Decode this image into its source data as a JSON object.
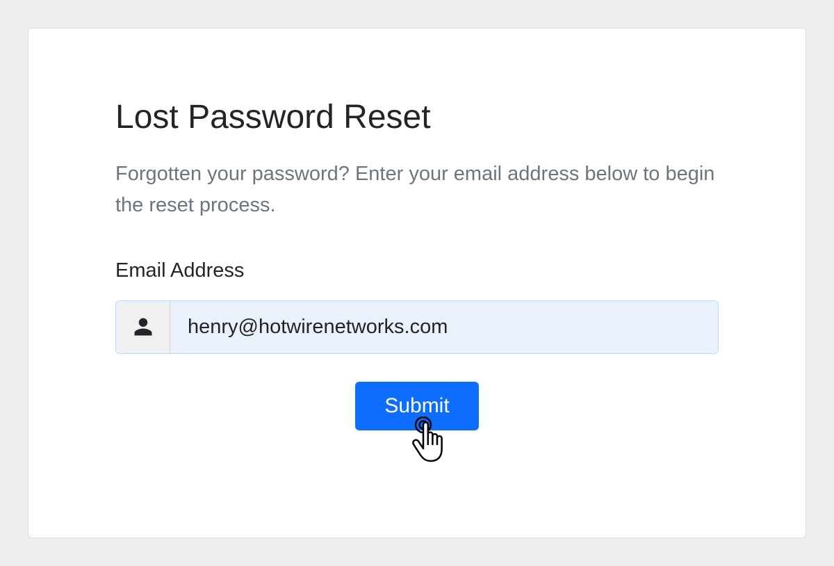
{
  "title": "Lost Password Reset",
  "description": "Forgotten your password? Enter your email address below to begin the reset process.",
  "form": {
    "email_label": "Email Address",
    "email_value": "henry@hotwirenetworks.com",
    "submit_label": "Submit"
  }
}
